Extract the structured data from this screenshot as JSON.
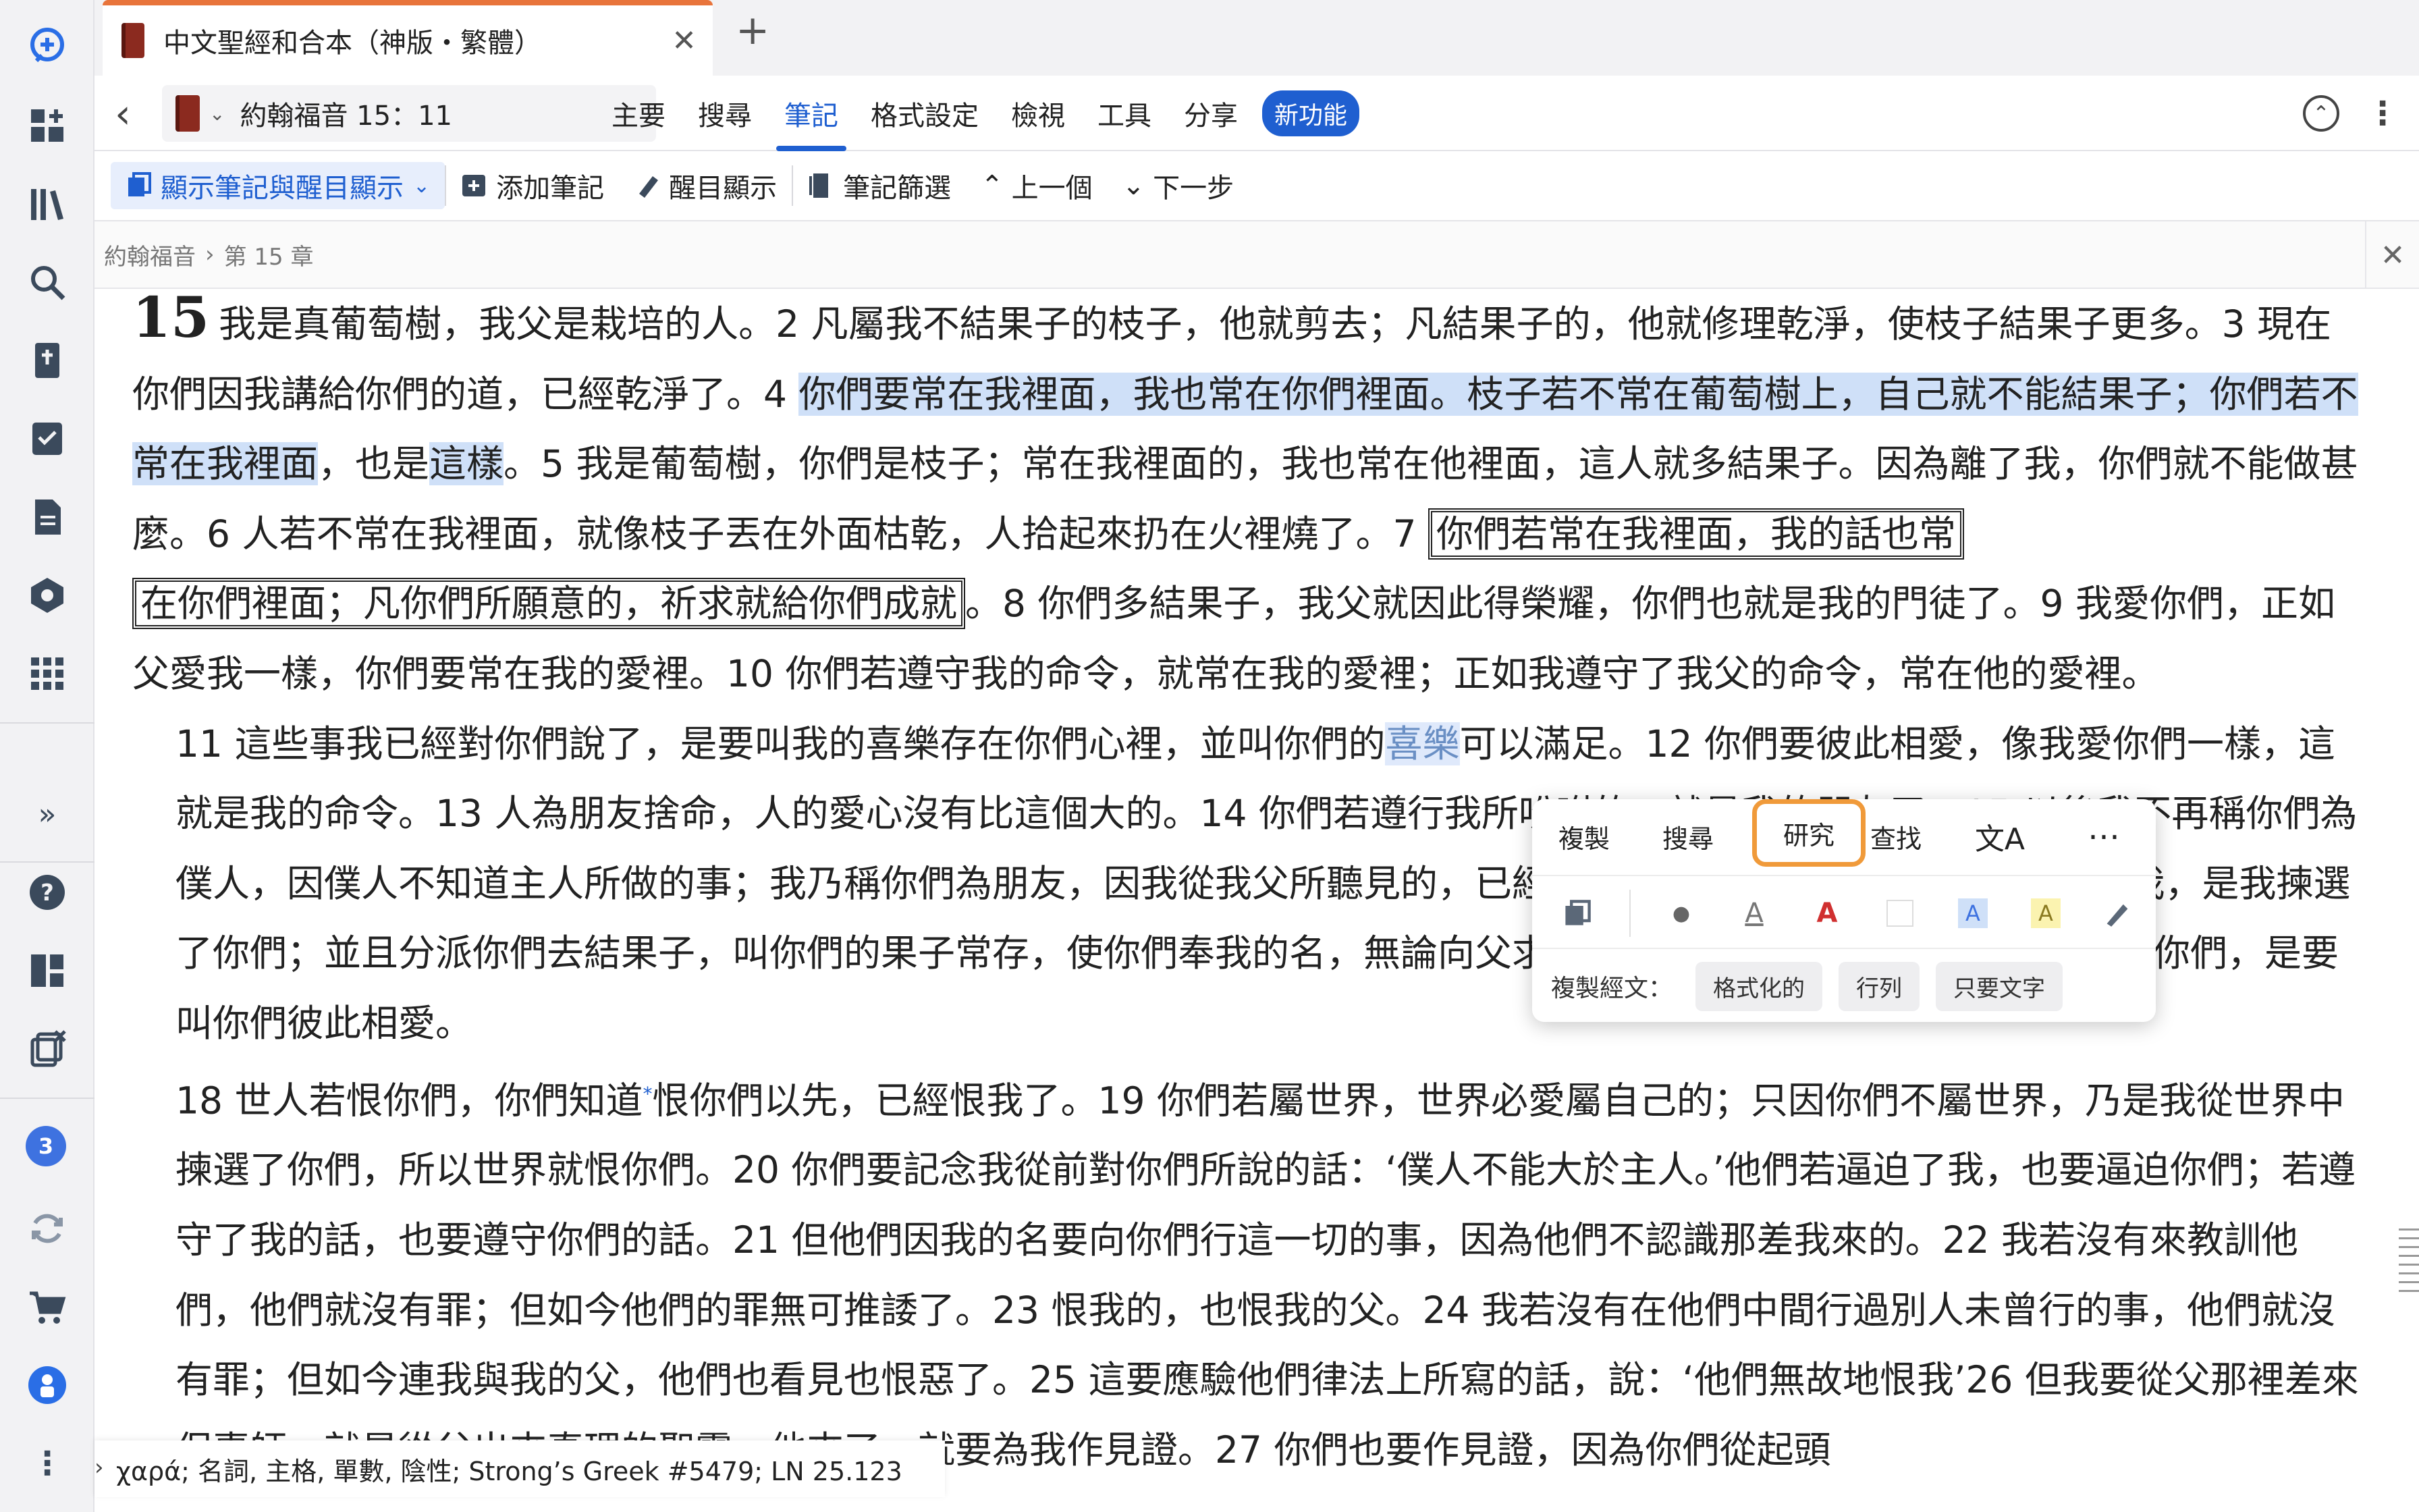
{
  "tab": {
    "title": "中文聖經和合本（神版・繁體）",
    "close": "✕",
    "add": "+"
  },
  "toolbar": {
    "reference": "約翰福音 15：11",
    "menu": [
      "主要",
      "搜尋",
      "筆記",
      "格式設定",
      "檢視",
      "工具",
      "分享"
    ],
    "active_menu": "筆記",
    "new_badge": "新功能"
  },
  "actions": {
    "show_notes": "顯示筆記與醒目顯示",
    "add_note": "添加筆記",
    "highlight": "醒目顯示",
    "note_filter": "筆記篩選",
    "prev": "上一個",
    "next": "下一步"
  },
  "breadcrumb": {
    "book": "約翰福音",
    "chapter": "第 15 章"
  },
  "text": {
    "chapter_num": "15",
    "p1_a": "我是真葡萄樹，我父是栽培的人。2 凡屬我不結果子的枝子，他就剪去；凡結果子的，他就修理乾淨，使枝子結果子更多。3 現在你們因我講給你們的道，已經乾淨了。4 ",
    "p1_hl1": "你們要常在我裡面，我也常",
    "p1_hl2": "在你們裡面。枝子若不常在葡萄樹上，自己就不能結果子；你們若不常在我裡面",
    "p1_b": "，也是",
    "p1_hl3": "這樣",
    "p1_c": "。5 我是葡萄樹，你們是枝子；常在我裡面的，我也常在他裡面，這人就多結果子。因為離了我，你們就不能做甚麼。6 人若不常在我裡面，就像枝子丟在外面枯乾，人拾起來扔在火裡燒了。7 ",
    "p1_box1": "你們若常在我裡面，我的話也常",
    "p1_box2": "在你們裡面；凡你們所願意的，祈求就給你們成就",
    "p1_d": "。8 你們多結果子，我父就因此得榮耀，你們也就是我的門徒了。9 我愛你們，正如父愛我一樣，你們要常在我的愛裡。10 你們若遵守我的命令，就常在我的愛裡；正如我遵守了我父的命令，常在他的愛裡。",
    "p2_a": "11 這些事我已經對你們說了，是要叫我的喜樂存在你們心裡，並叫你們的",
    "p2_word": "喜樂",
    "p2_b": "可以滿足。12 你們要彼此相愛，像我愛你們一樣，這就是我的命令。13 人為朋友捨命，人的愛心沒有比這個大的。14 你們若遵行",
    "p2_gap1": "我所吩咐的，就是我的朋友了。15 以後我不再稱",
    "p2_c": "你們為僕人，因僕人不知道主人所做的事；我乃稱你們為朋友，因我從我父所聽見",
    "p2_gap2": "的，已經都告訴你們了。16 不是你們揀選了我，",
    "p2_d": "是我揀選了你們；並且分派你們去結果子，叫你們的果子常存，使你們奉我的名，",
    "p2_gap3": "無論向父求甚麼，他就賜給你們。17",
    "p2_e": "我這樣吩咐你們，是要叫你們彼此相愛。",
    "p3_a": "18 世人若恨你們，你們知道",
    "p3_star": "*",
    "p3_b": "恨你們以先，已經恨我了。19 你們若屬世界，世界必愛屬自己的；只因你們不屬世界，乃是我從世界中揀選了你們，所以世界就恨你們。20 你們要記念我從前對你們所說的話：‘僕人不能大於主人。’他們若逼迫了我，也要逼迫你們；若遵守了我的話，也要遵守你們的話。21 但他們因我的名要向你們行這一切的事，因為他們不認識那差我來的。22 我若沒有來教訓他們，他們就沒有罪；但如今他們的罪無可推諉了。23 恨我的，也恨我的父。24 我若沒有在他們中間行過別人未曾行的事，他們就沒有罪；但如今連我與我的父，他們也看見也恨惡了。25 這要應驗他們律法上所寫的話，說：‘他們無故地恨我’26 但我要從父那裡差來保惠師，就是從父",
    "p3_c": "出來真理的聖靈，他來了，就要為我作見證。27 你們也要作見證，因為你們從起頭"
  },
  "popup": {
    "copy": "複製",
    "search": "搜尋",
    "research": "研究",
    "find": "查找",
    "more": "⋯",
    "copy_verse_label": "複製經文：",
    "chips": [
      "格式化的",
      "行列",
      "只要文字"
    ]
  },
  "status": {
    "text": "χαρά; 名詞, 主格, 單數, 陰性; Strong’s Greek #5479; LN 25.123"
  },
  "rail": {
    "badge": "3"
  },
  "colors": {
    "accent": "#1f5fd0",
    "highlight": "#cfe0f8",
    "research_ring": "#f09a3a",
    "tab_accent": "#e8743b"
  }
}
